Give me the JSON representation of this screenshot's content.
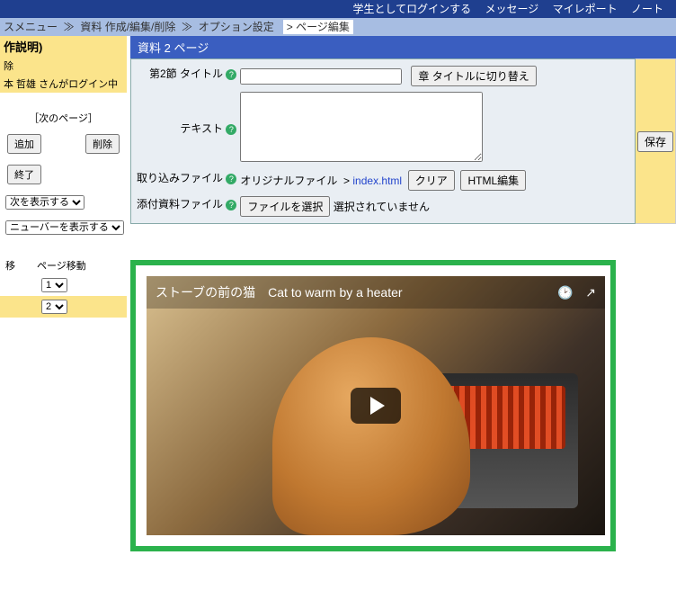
{
  "topbar": {
    "student": "学生としてログインする",
    "message": "メッセージ",
    "report": "マイレポート",
    "note": "ノート"
  },
  "breadcrumb": {
    "b1": "スメニュー",
    "b2": "資料 作成/編集/削除",
    "b3": "オプション設定",
    "current": "> ページ編集"
  },
  "side": {
    "hdr": "作説明)",
    "del": "除",
    "login": "本 哲雄 さんがログイン中",
    "next": "［次のページ］",
    "add": "追加",
    "delete": "削除",
    "end": "終了",
    "toc": "次を表示する",
    "menubar": "ニューバーを表示する",
    "moveLabelL": "移",
    "moveLabelR": "ページ移動",
    "sel1": "1",
    "sel2": "2"
  },
  "title": "資料 2 ページ",
  "form": {
    "sectionTitle": "第2節 タイトル",
    "value_title": "",
    "chapterToggle": "章 タイトルに切り替え",
    "textLabel": "テキスト",
    "value_text": "",
    "importLabel": "取り込みファイル",
    "original": "オリジナルファイル",
    "link": "index.html",
    "clear": "クリア",
    "htmlEdit": "HTML編集",
    "attachLabel": "添付資料ファイル",
    "choose": "ファイルを選択",
    "nofile": "選択されていません",
    "save": "保存"
  },
  "video": {
    "title": "ストーブの前の猫　Cat to warm by a heater"
  }
}
